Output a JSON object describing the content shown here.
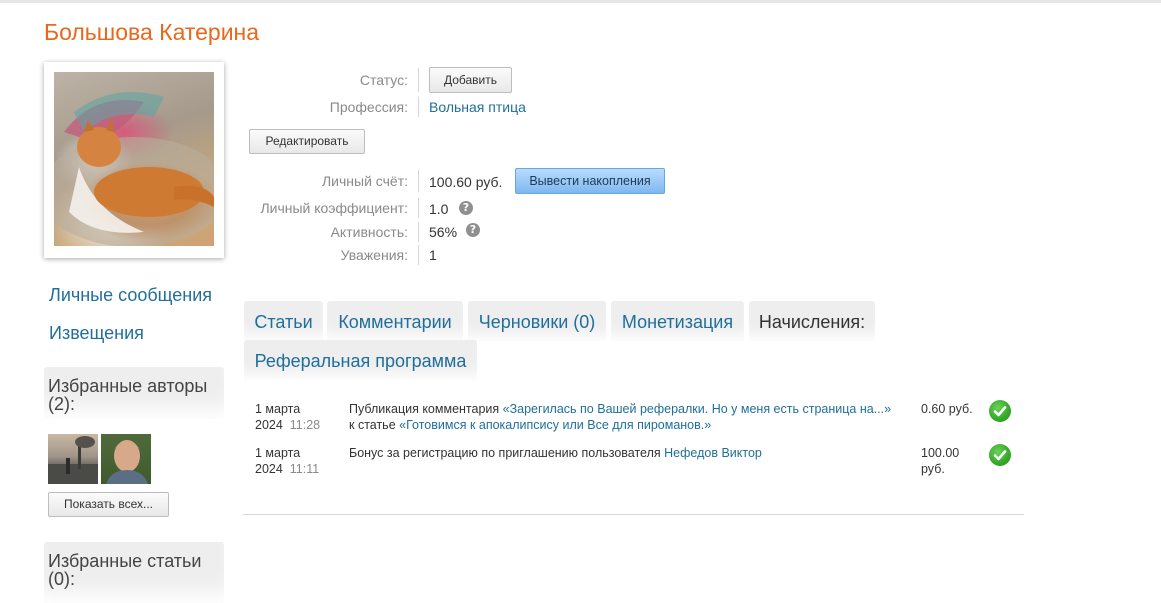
{
  "profile": {
    "name": "Большова Катерина",
    "photo_icon": "cat-photo"
  },
  "sidebar": {
    "messages_link": "Личные сообщения",
    "notifications_link": "Извещения",
    "fav_authors_title": "Избранные авторы (2):",
    "show_all_button": "Показать всех...",
    "fav_articles_title": "Избранные статьи (0):"
  },
  "info": {
    "status_label": "Статус:",
    "status_button": "Добавить",
    "profession_label": "Профессия:",
    "profession_value": "Вольная птица",
    "edit_button": "Редактировать",
    "account_label": "Личный счёт:",
    "account_value": "100.60 руб.",
    "withdraw_button": "Вывести накопления",
    "coef_label": "Личный коэффициент:",
    "coef_value": "1.0",
    "activity_label": "Активность:",
    "activity_value": "56%",
    "respect_label": "Уважения:",
    "respect_value": "1",
    "help_icon": "question-circle-icon"
  },
  "tabs": [
    {
      "label": "Статьи"
    },
    {
      "label": "Комментарии"
    },
    {
      "label": "Черновики (0)"
    },
    {
      "label": "Монетизация"
    },
    {
      "label": "Начисления:"
    },
    {
      "label": "Реферальная программа"
    }
  ],
  "accruals": [
    {
      "date": "1 марта 2024",
      "date_line1": "1 марта",
      "date_line2": "2024",
      "time": "11:28",
      "prefix": "Публикация комментария",
      "comment_link": "«Зарегилась по Вашей рефералки. Но у меня есть страница на...»",
      "middle": "к статье",
      "article_link": "«Готовимся к апокалипсису или Все для пироманов.»",
      "amount": "0.60 руб.",
      "status_icon": "check-circle-icon"
    },
    {
      "date": "1 марта 2024",
      "date_line1": "1 марта",
      "date_line2": "2024",
      "time": "11:11",
      "prefix": "Бонус за регистрацию по приглашению пользователя",
      "user_link": "Нефедов Виктор",
      "amount": "100.00 руб.",
      "status_icon": "check-circle-icon"
    }
  ],
  "colors": {
    "name": "#e8681c",
    "link": "#1f6f9a",
    "check": "#35a828"
  }
}
